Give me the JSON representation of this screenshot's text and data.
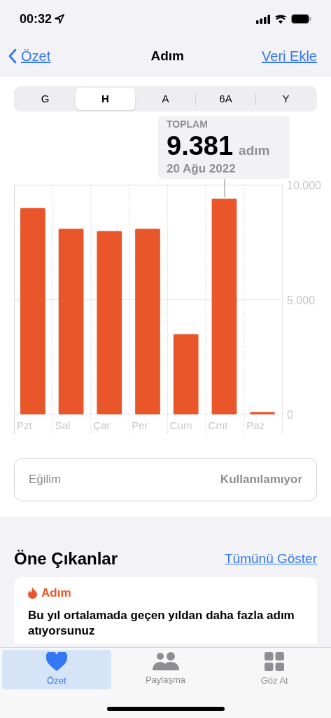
{
  "status_bar": {
    "time": "00:32"
  },
  "nav": {
    "back": "Özet",
    "title": "Adım",
    "action": "Veri Ekle"
  },
  "segments": [
    {
      "label": "G",
      "selected": false
    },
    {
      "label": "H",
      "selected": true
    },
    {
      "label": "A",
      "selected": false
    },
    {
      "label": "6A",
      "selected": false
    },
    {
      "label": "Y",
      "selected": false
    }
  ],
  "tooltip": {
    "label": "TOPLAM",
    "value": "9.381",
    "unit": "adım",
    "date": "20 Ağu 2022"
  },
  "chart": {
    "chart_data": {
      "type": "bar",
      "categories": [
        "Pzt",
        "Sal",
        "Çar",
        "Per",
        "Cum",
        "Cmt",
        "Paz"
      ],
      "series": [
        {
          "color": "#e8562a",
          "values": [
            9000,
            8100,
            8000,
            8100,
            3500,
            9400,
            100
          ]
        }
      ],
      "ylim": [
        0,
        10000
      ],
      "yticks": [
        {
          "value": 0,
          "label": "0"
        },
        {
          "value": 5000,
          "label": "5.000"
        },
        {
          "value": 10000,
          "label": "10.000"
        }
      ]
    }
  },
  "trend": {
    "label": "Eğilim",
    "value": "Kullanılamıyor"
  },
  "highlights": {
    "title": "Öne Çıkanlar",
    "link": "Tümünü Göster",
    "card": {
      "category": "Adım",
      "text": "Bu yıl ortalamada geçen yıldan daha fazla adım atıyorsunuz"
    }
  },
  "tab_bar": [
    {
      "label": "Özet",
      "kind": "heart",
      "selected": true
    },
    {
      "label": "Paylaşma",
      "kind": "people",
      "selected": false
    },
    {
      "label": "Göz At",
      "kind": "grid",
      "selected": false
    }
  ]
}
